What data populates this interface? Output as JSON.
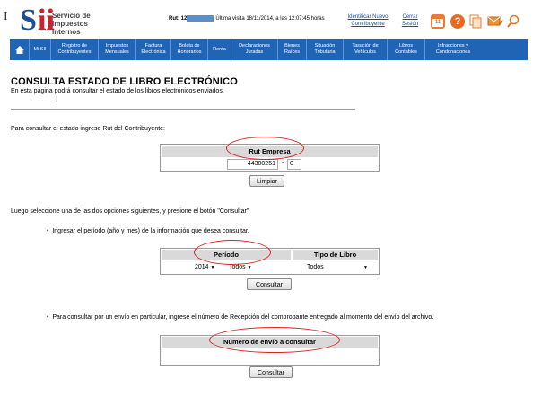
{
  "header": {
    "logo_letters_s": "S",
    "logo_letters_ii": "ii",
    "logo_text": "Servicio de Impuestos Internos",
    "rut_label": "Rut: 12",
    "last_visit": "Última visita 18/11/2014, a las 12:07:45 horas",
    "identify_link": "Identificar Nuevo Contribuyente",
    "close_link": "Cerrar Sesión",
    "icons": [
      "calendar-icon",
      "help-icon",
      "documents-icon",
      "mail-icon",
      "search-icon"
    ],
    "calendar_day": "11"
  },
  "nav": {
    "home_icon": "home-icon",
    "items": [
      "Mi SII",
      "Registro de Contribuyentes",
      "Impuestos Mensuales",
      "Factura Electrónica",
      "Boleta de Honorarios",
      "Renta",
      "Declaraciones Juradas",
      "Bienes Raíces",
      "Situación Tributaria",
      "Tasación de Vehículos",
      "Libros Contables",
      "Infracciones y Condonaciones"
    ],
    "color": "#1f64b5"
  },
  "main": {
    "title": "CONSULTA ESTADO DE LIBRO ELECTRÓNICO",
    "subtitle": "En esta página podrá consultar el estado de los libros electrónicos enviados.",
    "rut_prompt": "Para consultar el estado ingrese Rut del Contribuyente:",
    "rut_table": {
      "header": "Rut Empresa",
      "rut_value": "44300251",
      "dash": "-",
      "dv_value": "0"
    },
    "clear_button": "Limpiar",
    "options_prompt": "Luego seleccione una de las dos opciones siguientes, y presione el botón \"Consultar\"",
    "option1_text": "Ingresar el período (año y mes) de la información que desea consultar.",
    "period_table": {
      "header_period": "Período",
      "header_type": "Tipo de Libro",
      "year": "2014",
      "month": "Todos",
      "type": "Todos"
    },
    "consult_button": "Consultar",
    "option2_text": "Para consultar por un envío en particular, ingrese el número de Recepción del comprobante  entregado al momento del envío del archivo.",
    "envio_table": {
      "header": "Número de envío a consultar",
      "value": ""
    },
    "consult_button_2": "Consultar",
    "annotation_color": "#e02020"
  }
}
